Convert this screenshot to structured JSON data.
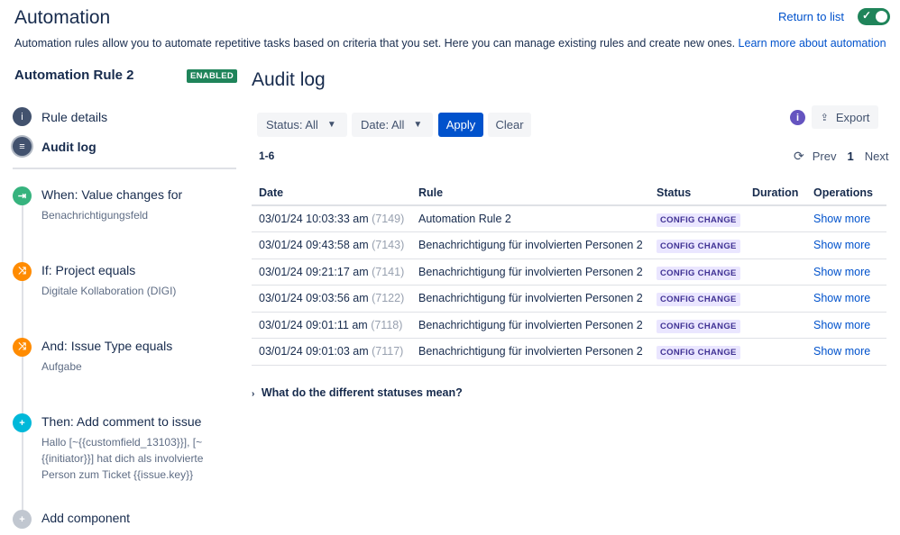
{
  "header": {
    "title": "Automation",
    "return_link": "Return to list",
    "description": "Automation rules allow you to automate repetitive tasks based on criteria that you set. Here you can manage existing rules and create new ones.",
    "learn_more": "Learn more about automation"
  },
  "sidebar": {
    "rule_name": "Automation Rule 2",
    "rule_state": "ENABLED",
    "nav": [
      {
        "label": "Rule details",
        "icon": "info-icon"
      },
      {
        "label": "Audit log",
        "icon": "list-icon",
        "active": true
      }
    ],
    "components": [
      {
        "title": "When: Value changes for",
        "sub": [
          "Benachrichtigungsfeld"
        ],
        "color": "#36b37e",
        "icon": "trigger-icon"
      },
      {
        "title": "If: Project equals",
        "sub": [
          "Digitale Kollaboration (DIGI)"
        ],
        "color": "#ff8b00",
        "icon": "condition-icon"
      },
      {
        "title": "And: Issue Type equals",
        "sub": [
          "Aufgabe"
        ],
        "color": "#ff8b00",
        "icon": "condition-icon"
      },
      {
        "title": "Then: Add comment to issue",
        "sub": [
          "Hallo [~{{customfield_13103}}], [~",
          "{{initiator}}] hat dich als involvierte",
          "Person zum Ticket {{issue.key}}"
        ],
        "color": "#00b8d9",
        "icon": "action-icon"
      }
    ],
    "add_component": "Add component"
  },
  "main": {
    "title": "Audit log",
    "filters": {
      "status": "Status: All",
      "date": "Date: All",
      "apply": "Apply",
      "clear": "Clear"
    },
    "export": "Export",
    "range": "1-6",
    "pager": {
      "prev": "Prev",
      "current": "1",
      "next": "Next"
    },
    "columns": [
      "Date",
      "Rule",
      "Status",
      "Duration",
      "Operations"
    ],
    "rows": [
      {
        "date": "03/01/24 10:03:33 am",
        "id": "(7149)",
        "rule": "Automation Rule 2",
        "status": "CONFIG CHANGE",
        "duration": "",
        "op": "Show more"
      },
      {
        "date": "03/01/24 09:43:58 am",
        "id": "(7143)",
        "rule": "Benachrichtigung für involvierten Personen 2",
        "status": "CONFIG CHANGE",
        "duration": "",
        "op": "Show more"
      },
      {
        "date": "03/01/24 09:21:17 am",
        "id": "(7141)",
        "rule": "Benachrichtigung für involvierten Personen 2",
        "status": "CONFIG CHANGE",
        "duration": "",
        "op": "Show more"
      },
      {
        "date": "03/01/24 09:03:56 am",
        "id": "(7122)",
        "rule": "Benachrichtigung für involvierten Personen 2",
        "status": "CONFIG CHANGE",
        "duration": "",
        "op": "Show more"
      },
      {
        "date": "03/01/24 09:01:11 am",
        "id": "(7118)",
        "rule": "Benachrichtigung für involvierten Personen 2",
        "status": "CONFIG CHANGE",
        "duration": "",
        "op": "Show more"
      },
      {
        "date": "03/01/24 09:01:03 am",
        "id": "(7117)",
        "rule": "Benachrichtigung für involvierten Personen 2",
        "status": "CONFIG CHANGE",
        "duration": "",
        "op": "Show more"
      }
    ],
    "faq": "What do the different statuses mean?"
  }
}
